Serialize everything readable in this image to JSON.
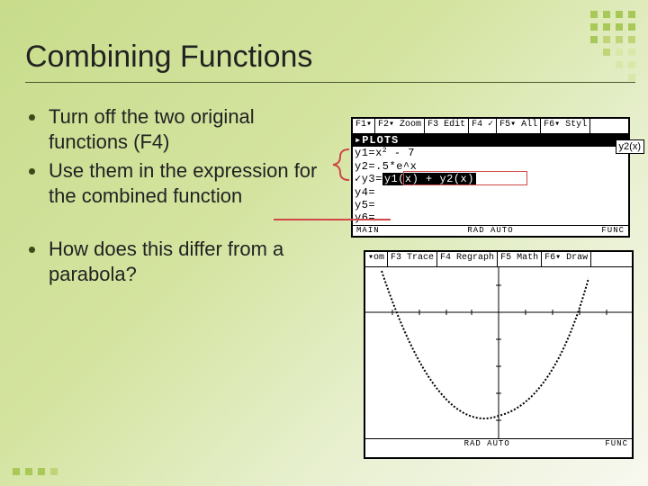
{
  "title": "Combining Functions",
  "bullets": {
    "b1": "Turn off the two original functions (F4)",
    "b2": "Use them in the expression for the combined function",
    "b3": "How does this differ from a parabola?"
  },
  "calc_top": {
    "menu": {
      "f1": "F1▾",
      "f2": "F2▾ Zoom",
      "f3": "F3 Edit",
      "f4": "F4 ✓",
      "f5": "F5▾ All",
      "f6": "F6▾ Styl"
    },
    "plots_label": "▸PLOTS",
    "y1": "y1=x",
    "y1_exp": "2",
    "y1_tail": " - 7",
    "y2": "y2=.5*e^x",
    "y3_prefix": "✓y3=",
    "y3_sel": "y1(x) + y2(x)",
    "y4": "y4=",
    "y5": "y5=",
    "y6": "y6=",
    "status_left": "MAIN",
    "status_mid": "RAD AUTO",
    "status_right": "FUNC"
  },
  "calc_bottom": {
    "menu": {
      "f1": "▾om",
      "f2": "F3 Trace",
      "f3": "F4 Regraph",
      "f4": "F5 Math",
      "f5": "F6▾ Draw"
    },
    "overlay": "y2(x)",
    "status_left": "",
    "status_mid": "RAD AUTO",
    "status_right": "FUNC"
  }
}
